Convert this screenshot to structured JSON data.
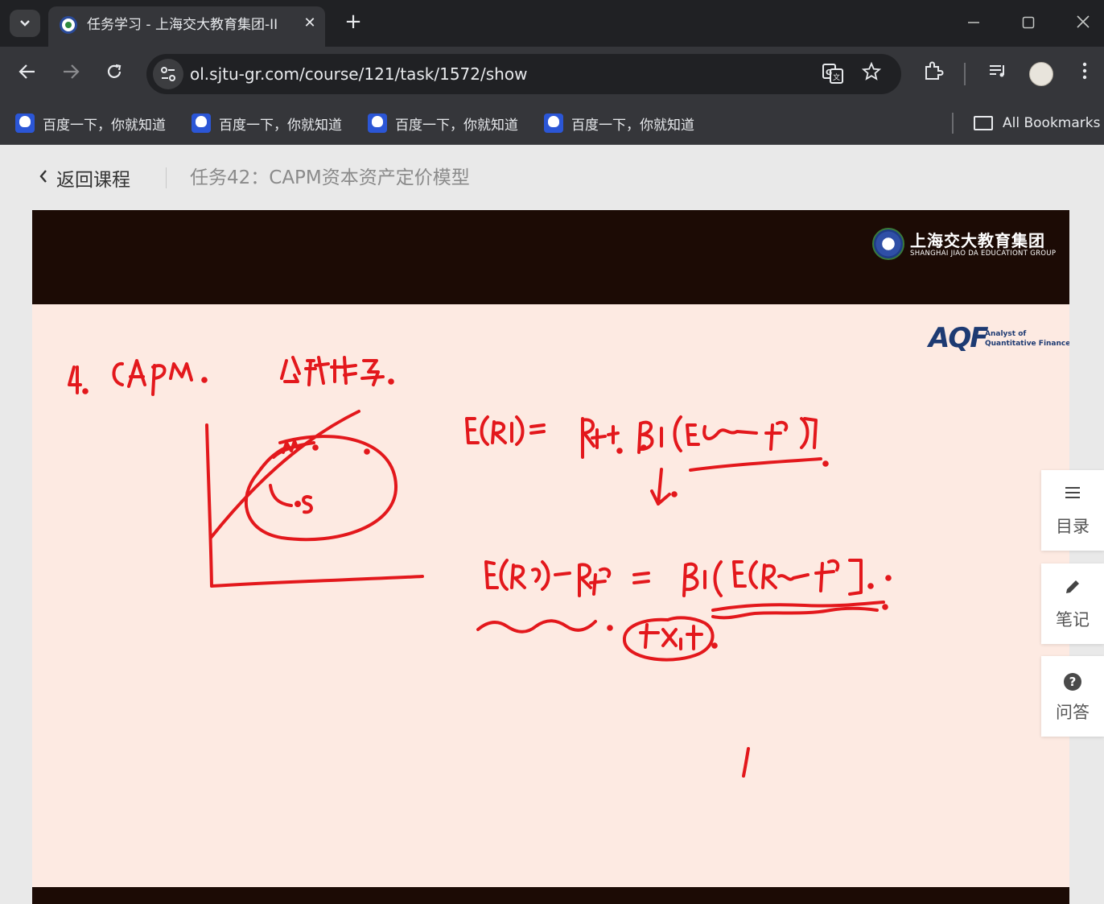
{
  "browser": {
    "tab_title": "任务学习 - 上海交大教育集团-ІІ",
    "tab_close": "✕",
    "new_tab": "+",
    "url": "ol.sjtu-gr.com/course/121/task/1572/show",
    "icons": {
      "tab_menu": "chevron-down-icon",
      "back": "arrow-left-icon",
      "forward": "arrow-right-icon",
      "reload": "reload-icon",
      "site_info": "tune-icon",
      "translate": "translate-icon",
      "star": "star-icon",
      "extensions": "puzzle-icon",
      "media": "media-queue-icon",
      "menu": "kebab-menu-icon"
    }
  },
  "bookmarks": {
    "items": [
      {
        "label": "百度一下，你就知道"
      },
      {
        "label": "百度一下，你就知道"
      },
      {
        "label": "百度一下，你就知道"
      },
      {
        "label": "百度一下，你就知道"
      }
    ],
    "all_bookmarks": "All Bookmarks"
  },
  "page": {
    "back_label": "返回课程",
    "task_title": "任务42：CAPM资本资产定价模型"
  },
  "video": {
    "brand_cn": "上海交大教育集团",
    "brand_en": "SHANGHAI JIAO DA EDUCATIONT GROUP",
    "aqf_mark": "AQF",
    "aqf_line1": "Analyst of",
    "aqf_line2": "Quantitative Finance",
    "ink_color": "#e3181c"
  },
  "side_panel": {
    "catalog": "目录",
    "notes": "笔记",
    "qa": "问答",
    "qa_symbol": "?"
  }
}
